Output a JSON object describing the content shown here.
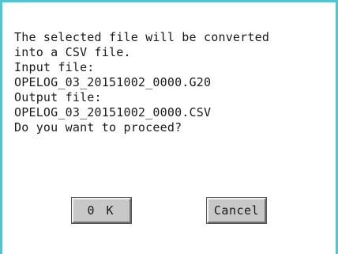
{
  "dialog": {
    "message_lines": [
      "The selected file will be converted",
      "into a CSV file.",
      "Input file:",
      "OPELOG_03_20151002_0000.G20",
      "Output file:",
      "OPELOG_03_20151002_0000.CSV",
      "Do you want to proceed?"
    ],
    "ok_label": "0 K",
    "cancel_label": "Cancel"
  },
  "colors": {
    "frame_accent": "#4fc4d2",
    "button_face": "#c8c8c8",
    "text": "#1a1a1a"
  }
}
